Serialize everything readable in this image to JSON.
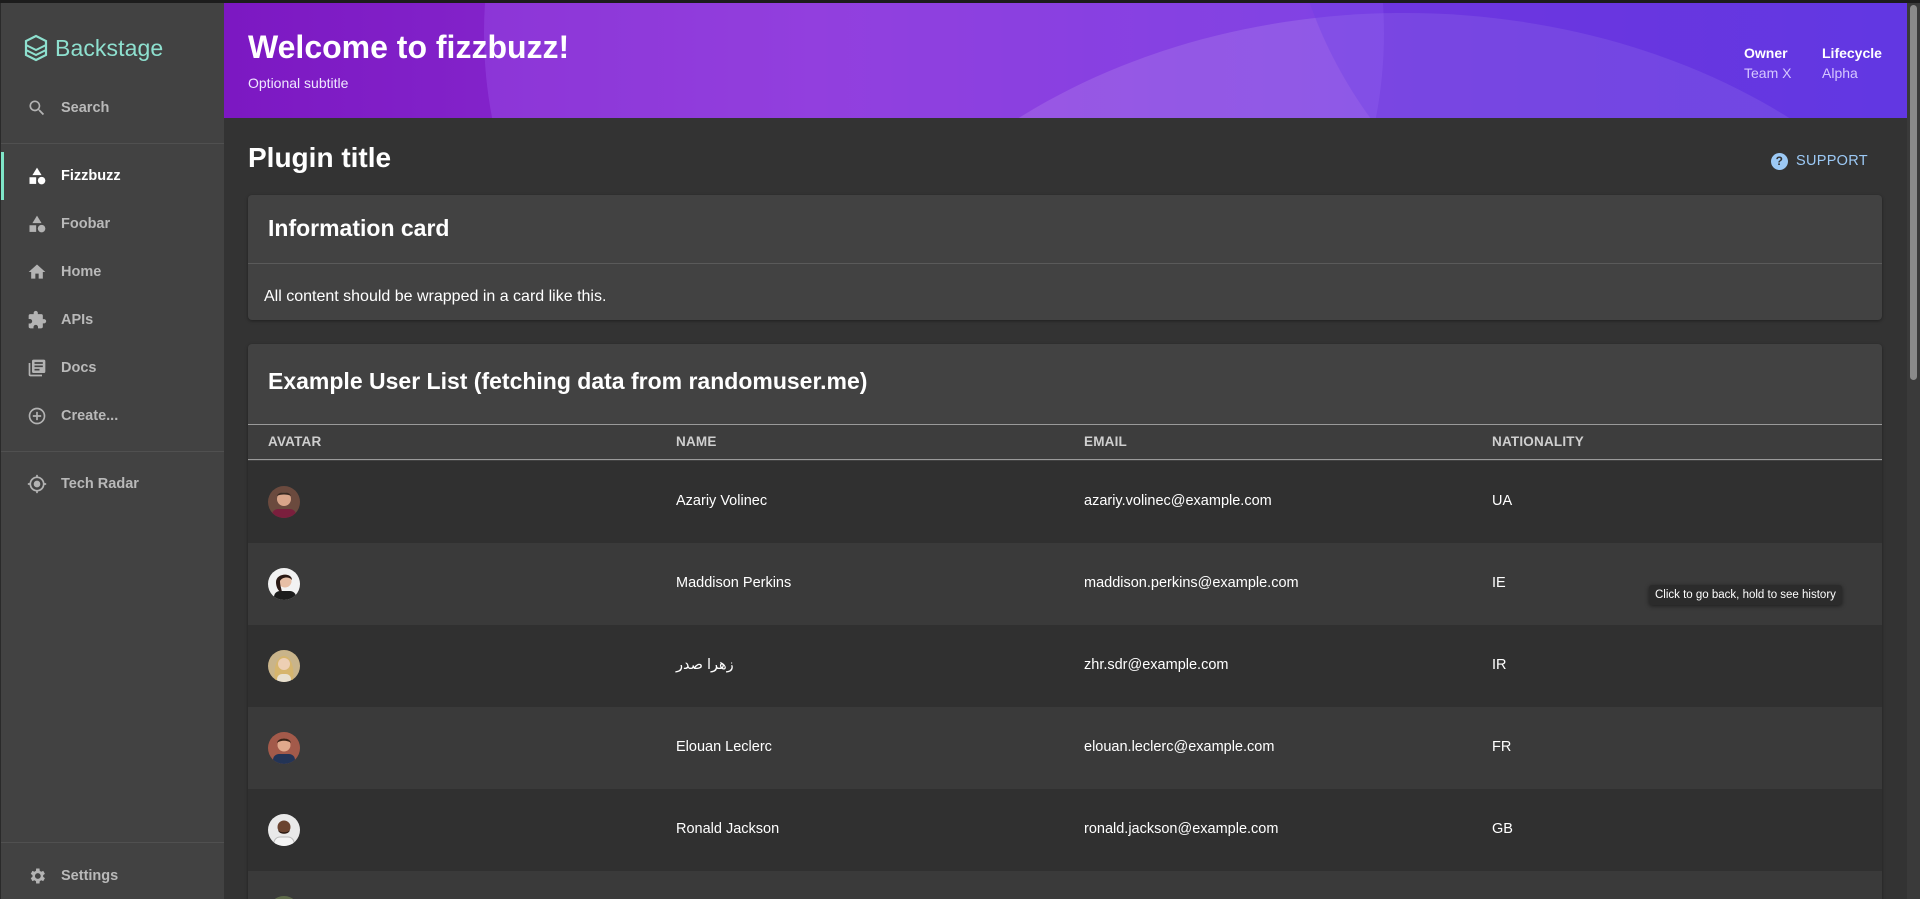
{
  "app": {
    "name": "Backstage"
  },
  "sidebar": {
    "search_label": "Search",
    "items": [
      {
        "label": "Fizzbuzz",
        "icon": "shapes-icon"
      },
      {
        "label": "Foobar",
        "icon": "shapes-icon"
      },
      {
        "label": "Home",
        "icon": "home-icon"
      },
      {
        "label": "APIs",
        "icon": "puzzle-icon"
      },
      {
        "label": "Docs",
        "icon": "library-icon"
      },
      {
        "label": "Create...",
        "icon": "add-circle-icon"
      }
    ],
    "tech_radar_label": "Tech Radar",
    "settings_label": "Settings"
  },
  "header": {
    "title": "Welcome to fizzbuzz!",
    "subtitle": "Optional subtitle",
    "owner_label": "Owner",
    "owner_value": "Team X",
    "lifecycle_label": "Lifecycle",
    "lifecycle_value": "Alpha"
  },
  "content": {
    "page_title": "Plugin title",
    "support_label": "SUPPORT",
    "info_card": {
      "title": "Information card",
      "body": "All content should be wrapped in a card like this."
    },
    "user_list": {
      "title": "Example User List (fetching data from randomuser.me)",
      "columns": [
        "AVATAR",
        "NAME",
        "EMAIL",
        "NATIONALITY"
      ],
      "rows": [
        {
          "name": "Azariy Volinec",
          "email": "azariy.volinec@example.com",
          "nationality": "UA"
        },
        {
          "name": "Maddison Perkins",
          "email": "maddison.perkins@example.com",
          "nationality": "IE"
        },
        {
          "name": "زهرا صدر",
          "email": "zhr.sdr@example.com",
          "nationality": "IR"
        },
        {
          "name": "Elouan Leclerc",
          "email": "elouan.leclerc@example.com",
          "nationality": "FR"
        },
        {
          "name": "Ronald Jackson",
          "email": "ronald.jackson@example.com",
          "nationality": "GB"
        }
      ]
    }
  },
  "tooltip": "Click to go back, hold to see history",
  "colors": {
    "accent": "#7fe6c8",
    "sidebar_bg": "#424242",
    "header_gradient_start": "#7c18c2",
    "header_gradient_end": "#5c35e0",
    "link": "#9cc9f5"
  }
}
